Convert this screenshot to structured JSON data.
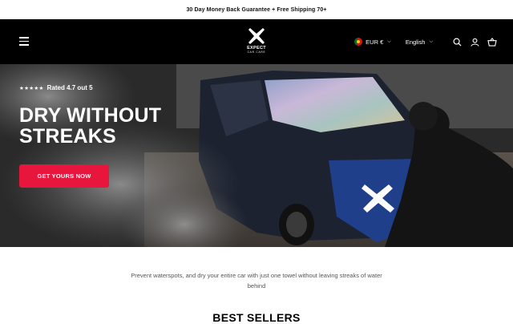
{
  "announcement": "30 Day Money Back Guarantee + Free Shipping 70+",
  "logo": {
    "word": "EXPECT",
    "sub": "CAR CARE"
  },
  "header": {
    "currency": "EUR €",
    "language": "English"
  },
  "hero": {
    "stars": "★★★★★",
    "rating": "Rated 4.7 out 5",
    "title": "DRY WITHOUT STREAKS",
    "cta": "GET YOURS NOW"
  },
  "tagline": "Prevent waterspots, and dry your entire car with just one towel without leaving streaks of water behind",
  "section_title": "BEST SELLERS",
  "colors": {
    "accent": "#e8153c",
    "header_bg": "#000000"
  },
  "icons": [
    "menu-icon",
    "search-icon",
    "account-icon",
    "cart-icon",
    "chevron-down-icon"
  ]
}
